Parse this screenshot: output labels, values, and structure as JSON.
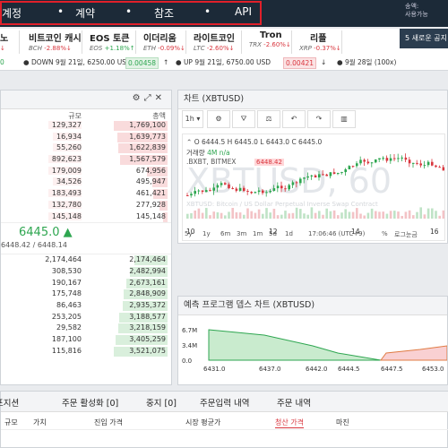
{
  "nav": {
    "items": [
      "계정",
      "계약",
      "참조",
      "API"
    ],
    "account_line1": "송액:",
    "account_line2": "사용가능"
  },
  "tickers": [
    {
      "name": "노",
      "sub_symbol": "",
      "change": "",
      "dir": "down"
    },
    {
      "name": "비트코인 캐시",
      "sub_symbol": "BCH",
      "change": "-2.88%",
      "dir": "down"
    },
    {
      "name": "EOS 토큰",
      "sub_symbol": "EOS",
      "change": "+1.18%",
      "dir": "up"
    },
    {
      "name": "이더리움",
      "sub_symbol": "ETH",
      "change": "-0.09%",
      "dir": "down"
    },
    {
      "name": "라이트코인",
      "sub_symbol": "LTC",
      "change": "-2.60%",
      "dir": "down"
    },
    {
      "name": "Tron",
      "sub_symbol": "TRX",
      "change": "-2.60%",
      "dir": "down"
    },
    {
      "name": "리플",
      "sub_symbol": "XRP",
      "change": "-0.37%",
      "dir": "down"
    }
  ],
  "notify": "5 새로운 공지",
  "feed": {
    "f0": "0",
    "f1": "DOWN 9월 21일, 6250.00 USD",
    "f2": "0.00458",
    "f3": "UP 9월 21일, 6750.00 USD",
    "f4": "0.00421",
    "f5": "9월 28일 (100x)"
  },
  "orderbook": {
    "col_size": "규모",
    "col_total": "총액",
    "asks": [
      {
        "size": "129,327",
        "total": "1,769,100"
      },
      {
        "size": "16,934",
        "total": "1,639,773"
      },
      {
        "size": "55,260",
        "total": "1,622,839"
      },
      {
        "size": "892,623",
        "total": "1,567,579"
      },
      {
        "size": "179,009",
        "total": "674,956"
      },
      {
        "size": "34,526",
        "total": "495,947"
      },
      {
        "size": "183,493",
        "total": "461,421"
      },
      {
        "size": "132,780",
        "total": "277,928"
      },
      {
        "size": "145,148",
        "total": "145,148"
      }
    ],
    "last_price": "6445.0",
    "sub_price": "6448.42 / 6448.14",
    "bids": [
      {
        "size": "2,174,464",
        "total": "2,174,464"
      },
      {
        "size": "308,530",
        "total": "2,482,994"
      },
      {
        "size": "190,167",
        "total": "2,673,161"
      },
      {
        "size": "175,748",
        "total": "2,848,909"
      },
      {
        "size": "86,463",
        "total": "2,935,372"
      },
      {
        "size": "253,205",
        "total": "3,188,577"
      },
      {
        "size": "29,582",
        "total": "3,218,159"
      },
      {
        "size": "187,100",
        "total": "3,405,259"
      },
      {
        "size": "115,816",
        "total": "3,521,075"
      }
    ]
  },
  "chart_panel": {
    "title": "차트 (XBTUSD)",
    "interval": "1h",
    "ohlc": "O 6444.5 H 6445.0 L 6443.0 C 6445.0",
    "volume_label": "거래량",
    "volume_value": "4M n/a",
    "exchanges": ".BXBT, BITMEX",
    "price_tag": "6448.42",
    "watermark": "XBTUSD, 60",
    "watermark_sub": "XBTUSD: Bitcoin / US Dollar Perpetual Inverse Swap Contract",
    "x_labels": [
      "10",
      "12",
      "14",
      "16"
    ],
    "time_display": "17:06:46 (UTC+9)",
    "percent": "%",
    "log": "로그눈금",
    "range_buttons": [
      "5y",
      "1y",
      "6m",
      "3m",
      "1m",
      "5d",
      "1d"
    ]
  },
  "depth_panel": {
    "title": "예측 프로그램 뎁스 차트 (XBTUSD)",
    "y_labels": [
      "6.7M",
      "3.4M",
      "0.0"
    ],
    "x_labels": [
      "6431.0",
      "6437.0",
      "6442.0",
      "6444.5",
      "6447.5",
      "6453.0"
    ]
  },
  "bottom": {
    "tabs": [
      "포지션",
      "주문 활성화 [0]",
      "중지 [0]",
      "주문입력 내역",
      "주문 내역"
    ],
    "cols": [
      "규모",
      "가치",
      "진입 가격",
      "시장 평균가",
      "청산 가격",
      "마진"
    ]
  },
  "colors": {
    "up": "#2ea650",
    "down": "#d9363e",
    "nav_bg": "#1c2a38",
    "highlight": "#e0202a"
  }
}
